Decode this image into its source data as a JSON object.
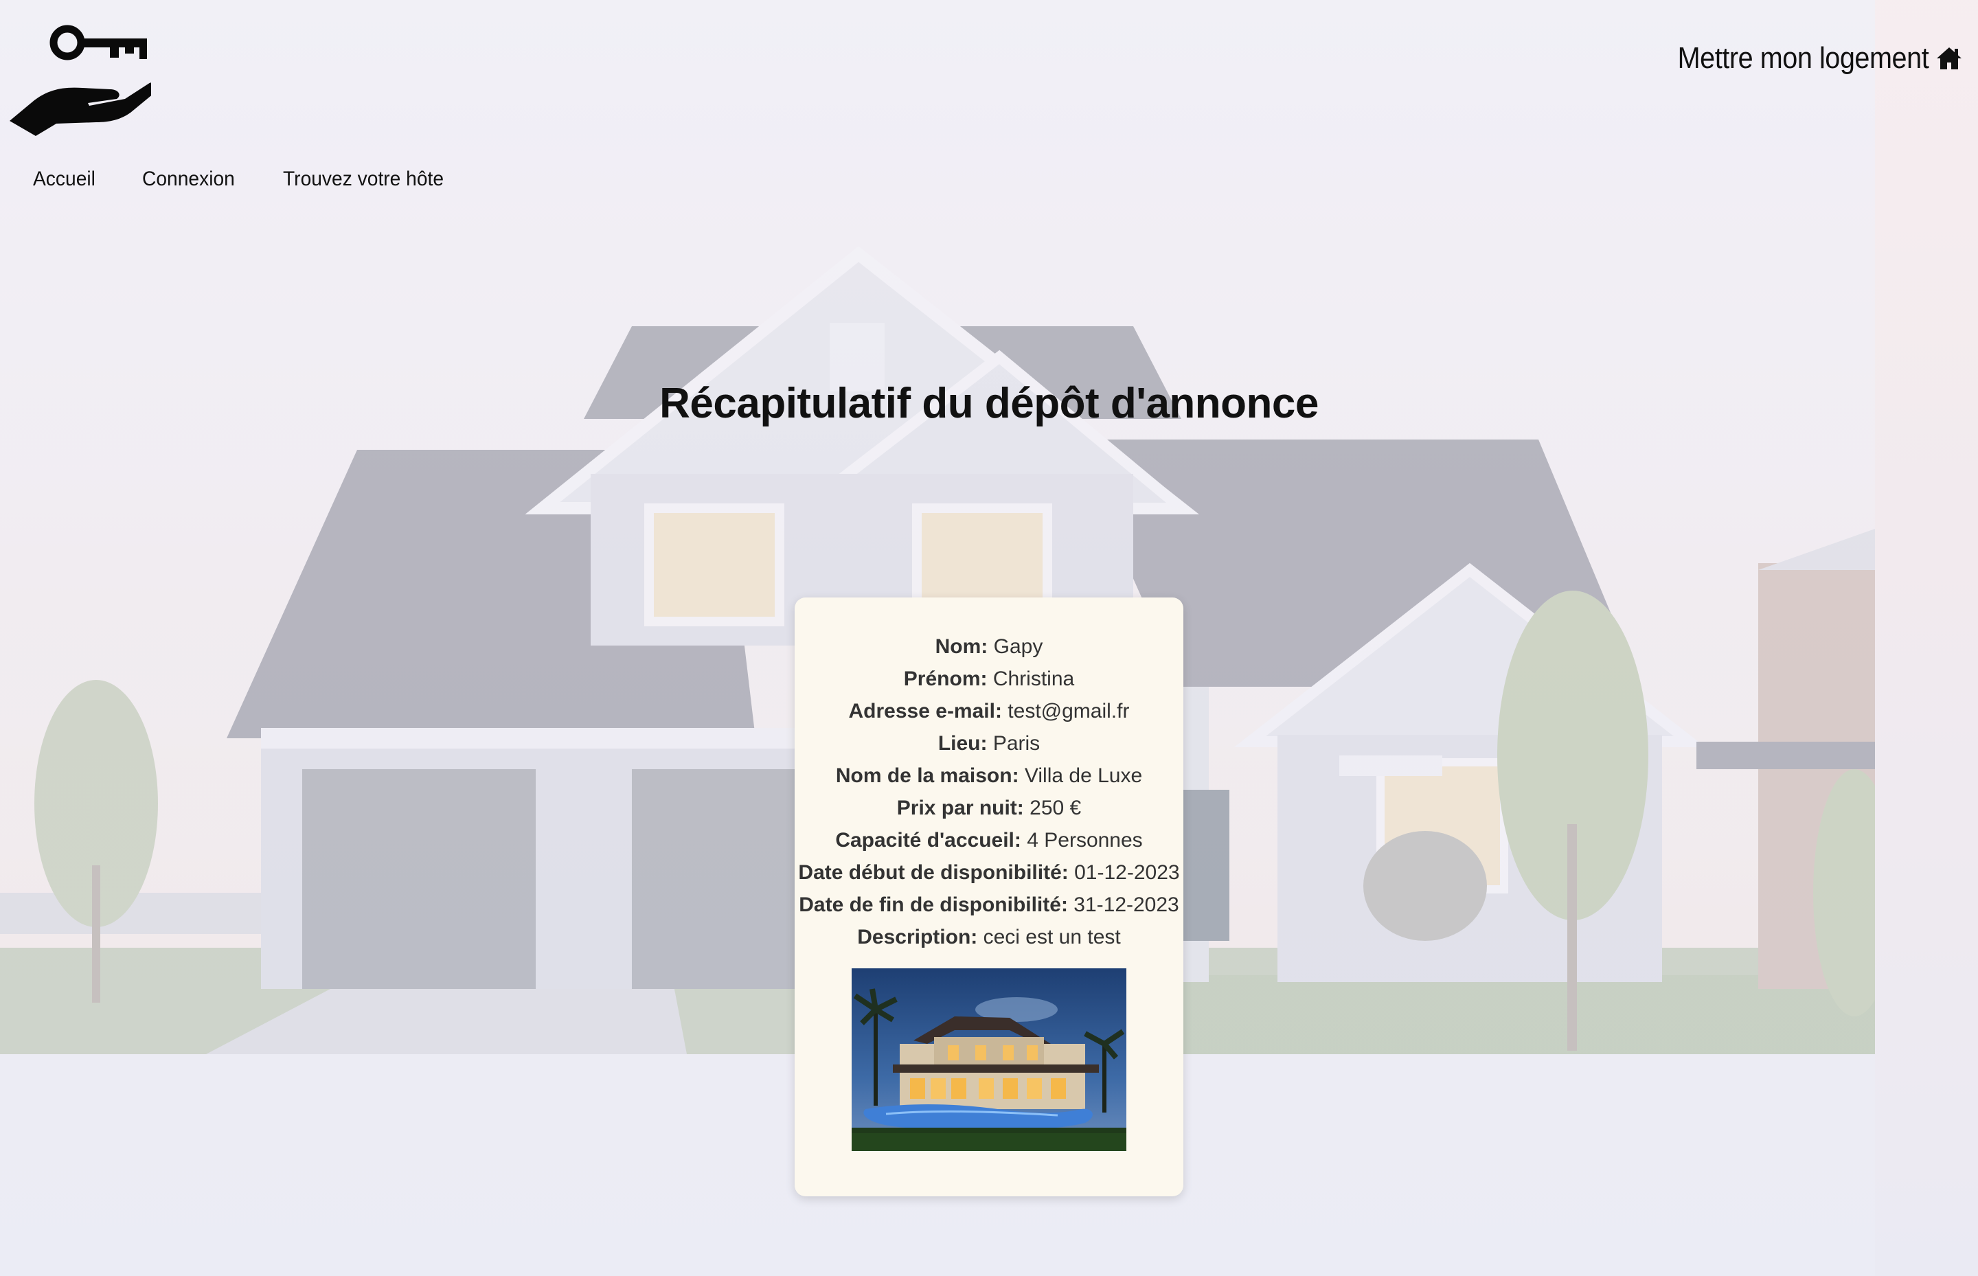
{
  "header": {
    "host_link_label": "Mettre mon logement"
  },
  "nav": {
    "items": [
      {
        "label": "Accueil"
      },
      {
        "label": "Connexion"
      },
      {
        "label": "Trouvez votre hôte"
      }
    ]
  },
  "page_title": "Récapitulatif du dépôt d'annonce",
  "summary": {
    "rows": [
      {
        "label": "Nom:",
        "value": "Gapy"
      },
      {
        "label": "Prénom:",
        "value": "Christina"
      },
      {
        "label": "Adresse e-mail:",
        "value": "test@gmail.fr"
      },
      {
        "label": "Lieu:",
        "value": "Paris"
      },
      {
        "label": "Nom de la maison:",
        "value": "Villa de Luxe"
      },
      {
        "label": "Prix par nuit:",
        "value": "250 €"
      },
      {
        "label": "Capacité d'accueil:",
        "value": "4 Personnes"
      },
      {
        "label": "Date début de disponibilité:",
        "value": "01-12-2023"
      },
      {
        "label": "Date de fin de disponibilité:",
        "value": "31-12-2023"
      },
      {
        "label": "Description:",
        "value": "ceci est un test"
      }
    ]
  },
  "icons": {
    "logo": "key-in-hand-icon",
    "host_link": "home-icon"
  },
  "colors": {
    "card_bg": "#fcf8ee",
    "text": "#111111"
  }
}
